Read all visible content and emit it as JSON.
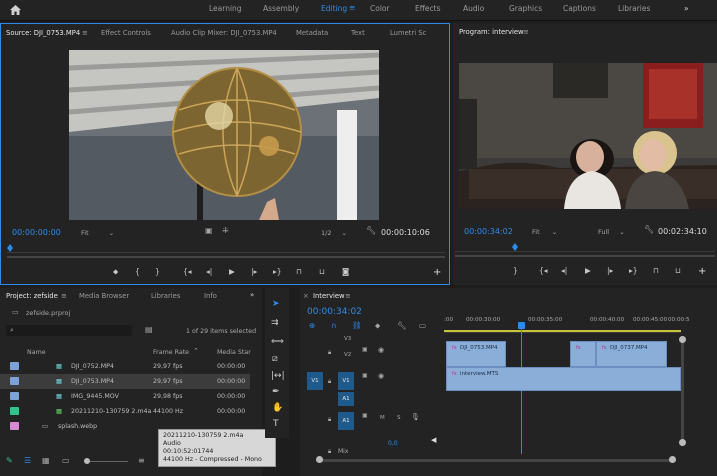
{
  "workspaces": [
    "Learning",
    "Assembly",
    "Editing",
    "Color",
    "Effects",
    "Audio",
    "Graphics",
    "Captions",
    "Libraries"
  ],
  "workspace_more": "»",
  "source": {
    "tabs": [
      "Source: DJI_0753.MP4",
      "Effect Controls",
      "Audio Clip Mixer: DJI_0753.MP4",
      "Metadata",
      "Text",
      "Lumetri Sc"
    ],
    "timecode": "00:00:00:00",
    "fit": "Fit",
    "resolution": "1/2",
    "duration": "00:00:10:06",
    "tab_menu": "≡"
  },
  "program": {
    "tab": "Program: interview",
    "timecode": "00:00:34:02",
    "fit": "Fit",
    "quality": "Full",
    "duration": "00:02:34:10",
    "tab_menu": "≡"
  },
  "project": {
    "tabs": [
      "Project: zefside",
      "Media Browser",
      "Libraries",
      "Info"
    ],
    "file": "zefside.prproj",
    "items_selected": "1 of 29 items selected",
    "columns": {
      "name": "Name",
      "frame_rate": "Frame Rate",
      "media_start": "Media Star"
    },
    "rows": [
      {
        "color": "#7da2d9",
        "name": "DJI_0752.MP4",
        "fps": "29,97 fps",
        "start": "00:00:00"
      },
      {
        "color": "#7da2d9",
        "name": "DJI_0753.MP4",
        "fps": "29,97 fps",
        "start": "00:00:00"
      },
      {
        "color": "#7da2d9",
        "name": "IMG_9445.MOV",
        "fps": "29,98 fps",
        "start": "00:00:00"
      },
      {
        "color": "#36c28f",
        "name": "20211210-130759 2.m4a",
        "fps": "44100 Hz",
        "start": "00:00:00"
      },
      {
        "color": "#d98ad3",
        "name": "splash.webp",
        "fps": "",
        "start": ""
      }
    ],
    "tooltip": [
      "20211210-130759 2.m4a",
      "Audio",
      "00:10:52:01744",
      "44100 Hz - Compressed - Mono"
    ]
  },
  "timeline": {
    "tab": "Interview",
    "tab_menu": "≡",
    "timecode": "00:00:34:02",
    "ruler": [
      ":00",
      "00:00:30:00",
      "00:00:35:00",
      "00:00:40:00",
      "00:00:45:00",
      "00:00:5"
    ],
    "tracks": {
      "v3": "V3",
      "v2": "V2",
      "v1": "V1",
      "v1b": "V1",
      "a1": "A1",
      "a1b": "A1",
      "mix": "Mix",
      "mix_value": "0,0",
      "m": "M",
      "s": "S"
    },
    "clips": {
      "c1": "DJI_0753.MP4",
      "c2": "fx",
      "c3": "DJI_0737.MP4",
      "c4": "interview.MTS"
    }
  },
  "icons": {
    "home": "home-icon",
    "settings": "wrench-icon"
  }
}
